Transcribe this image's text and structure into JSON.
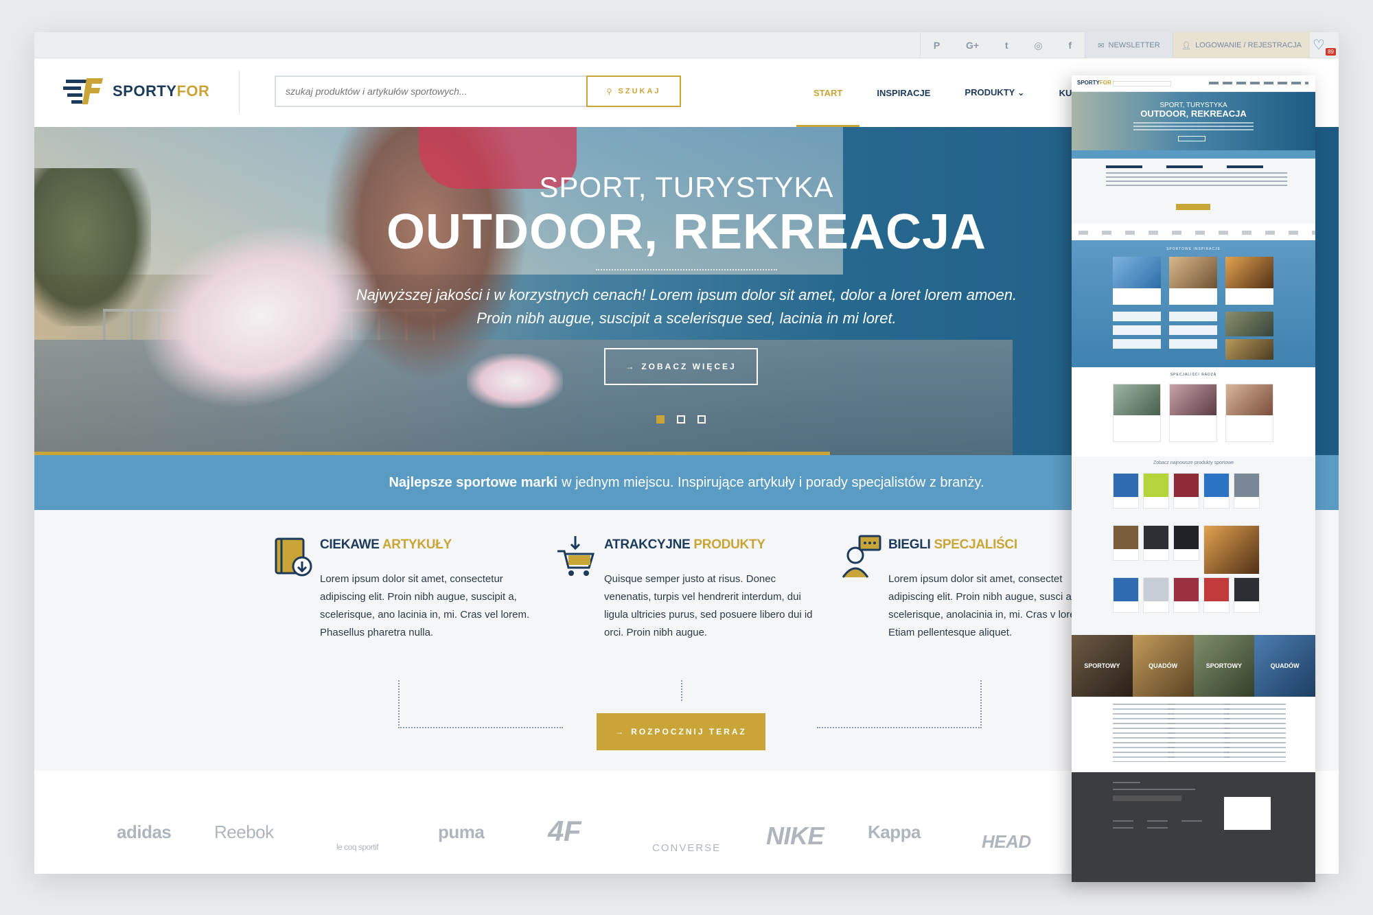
{
  "topbar": {
    "social": [
      "pinterest-icon",
      "google-plus-icon",
      "twitter-icon",
      "instagram-icon",
      "facebook-icon"
    ],
    "social_glyphs": [
      "P",
      "G+",
      "t",
      "◎",
      "f"
    ],
    "newsletter": "NEWSLETTER",
    "login": "LOGOWANIE / REJESTRACJA",
    "favorites_count": "89"
  },
  "header": {
    "logo_a": "SPORTY",
    "logo_b": "FOR",
    "search_placeholder": "szukaj produktów i artykułów sportowych...",
    "search_button": "SZUKAJ",
    "nav": [
      {
        "label": "START",
        "active": true
      },
      {
        "label": "INSPIRACJE"
      },
      {
        "label": "PRODUKTY ⌄"
      },
      {
        "label": "KUPUJ TA"
      }
    ]
  },
  "hero": {
    "kicker": "SPORT, TURYSTYKA",
    "title": "OUTDOOR, REKREACJA",
    "lead_1": "Najwyższej jakości i w korzystnych cenach! Lorem ipsum dolor sit amet, dolor a loret lorem amoen.",
    "lead_2": "Proin nibh augue, suscipit a scelerisque sed, lacinia in mi loret.",
    "cta": "ZOBACZ WIĘCEJ",
    "slides": 3,
    "active_slide": 1
  },
  "band": {
    "bold": "Najlepsze sportowe marki",
    "rest": "w jednym miejscu. Inspirujące artykuły i porady specjalistów z branży."
  },
  "features": [
    {
      "icon": "book-download-icon",
      "title_a": "CIEKAWE",
      "title_b": "ARTYKUŁY",
      "text": "Lorem ipsum dolor sit amet, consectetur adipiscing elit. Proin nibh augue, suscipit a, scelerisque, ano lacinia in, mi. Cras vel lorem. Phasellus pharetra nulla."
    },
    {
      "icon": "cart-download-icon",
      "title_a": "ATRAKCYJNE",
      "title_b": "PRODUKTY",
      "text": "Quisque semper justo at risus. Donec venenatis, turpis vel hendrerit interdum, dui ligula ultricies purus, sed posuere libero dui id orci. Proin nibh augue."
    },
    {
      "icon": "specialist-chat-icon",
      "title_a": "BIEGLI",
      "title_b": "SPECJALIŚCI",
      "text": "Lorem ipsum dolor sit amet, consectet adipiscing elit. Proin nibh augue, susci a, scelerisque, anolacinia in, mi. Cras v lorem. Etiam pellentesque aliquet."
    }
  ],
  "start_button": "ROZPOCZNIJ TERAZ",
  "brands": [
    "adidas",
    "Reebok",
    "le coq sportif",
    "puma",
    "4F",
    "CONVERSE",
    "NIKE",
    "Kappa",
    "HEAD"
  ],
  "preview": {
    "hero_kicker": "SPORT, TURYSTYKA",
    "hero_title": "OUTDOOR, REKREACJA",
    "inspiration_title": "SPORTOWE INSPIRACJE",
    "specialists_title": "SPECJALIŚCI RADZĄ",
    "products_title": "Zobacz najnowsze produkty sportowe",
    "banners": [
      "SPORTOWY",
      "QUADÓW",
      "SPORTOWY",
      "QUADÓW"
    ]
  },
  "colors": {
    "navy": "#1b3a5c",
    "gold": "#c9a437",
    "band_blue": "#5a9bc4"
  }
}
